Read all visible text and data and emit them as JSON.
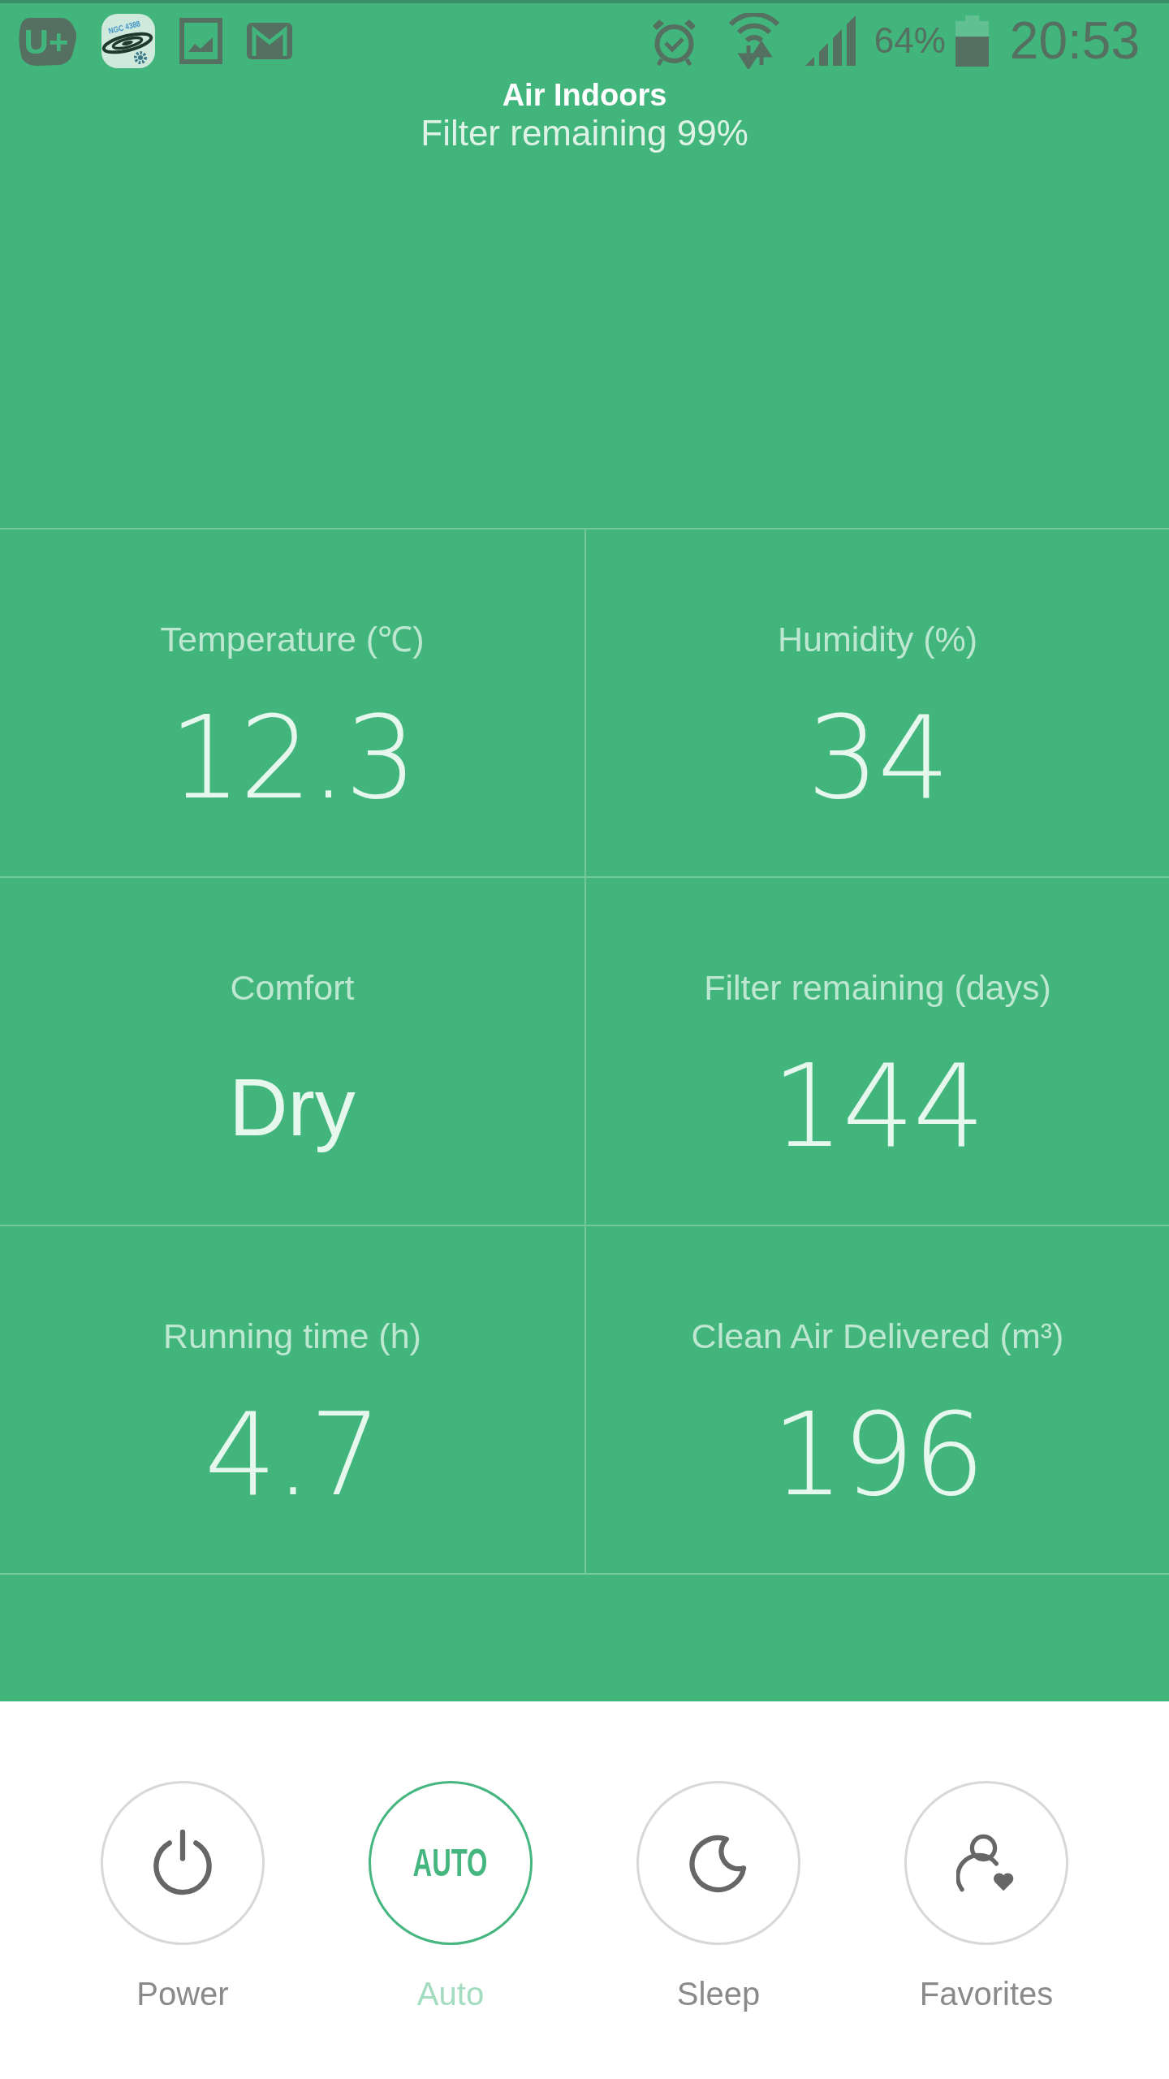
{
  "status_bar": {
    "notifications": [
      {
        "kind": "u-plus",
        "text": "U+"
      },
      {
        "kind": "galaxy",
        "text": "NGC 4388"
      },
      {
        "kind": "picture"
      },
      {
        "kind": "mail"
      }
    ],
    "battery_text": "64%",
    "time": "20:53"
  },
  "header": {
    "title": "Air Indoors",
    "subtitle": "Filter remaining 99%"
  },
  "metrics": [
    {
      "label": "Temperature (℃)",
      "value": "12.3",
      "kind": "number"
    },
    {
      "label": "Humidity (%)",
      "value": "34",
      "kind": "number"
    },
    {
      "label": "Comfort",
      "value": "Dry",
      "kind": "word"
    },
    {
      "label": "Filter remaining (days)",
      "value": "144",
      "kind": "number"
    },
    {
      "label": "Running time (h)",
      "value": "4.7",
      "kind": "number"
    },
    {
      "label": "Clean Air Delivered (m³)",
      "value": "196",
      "kind": "number"
    }
  ],
  "modes": [
    {
      "label": "Power",
      "kind": "power",
      "selected": false
    },
    {
      "label": "Auto",
      "kind": "auto",
      "icon_text": "AUTO",
      "selected": true
    },
    {
      "label": "Sleep",
      "kind": "sleep",
      "selected": false
    },
    {
      "label": "Favorites",
      "kind": "favorites",
      "selected": false
    }
  ]
}
